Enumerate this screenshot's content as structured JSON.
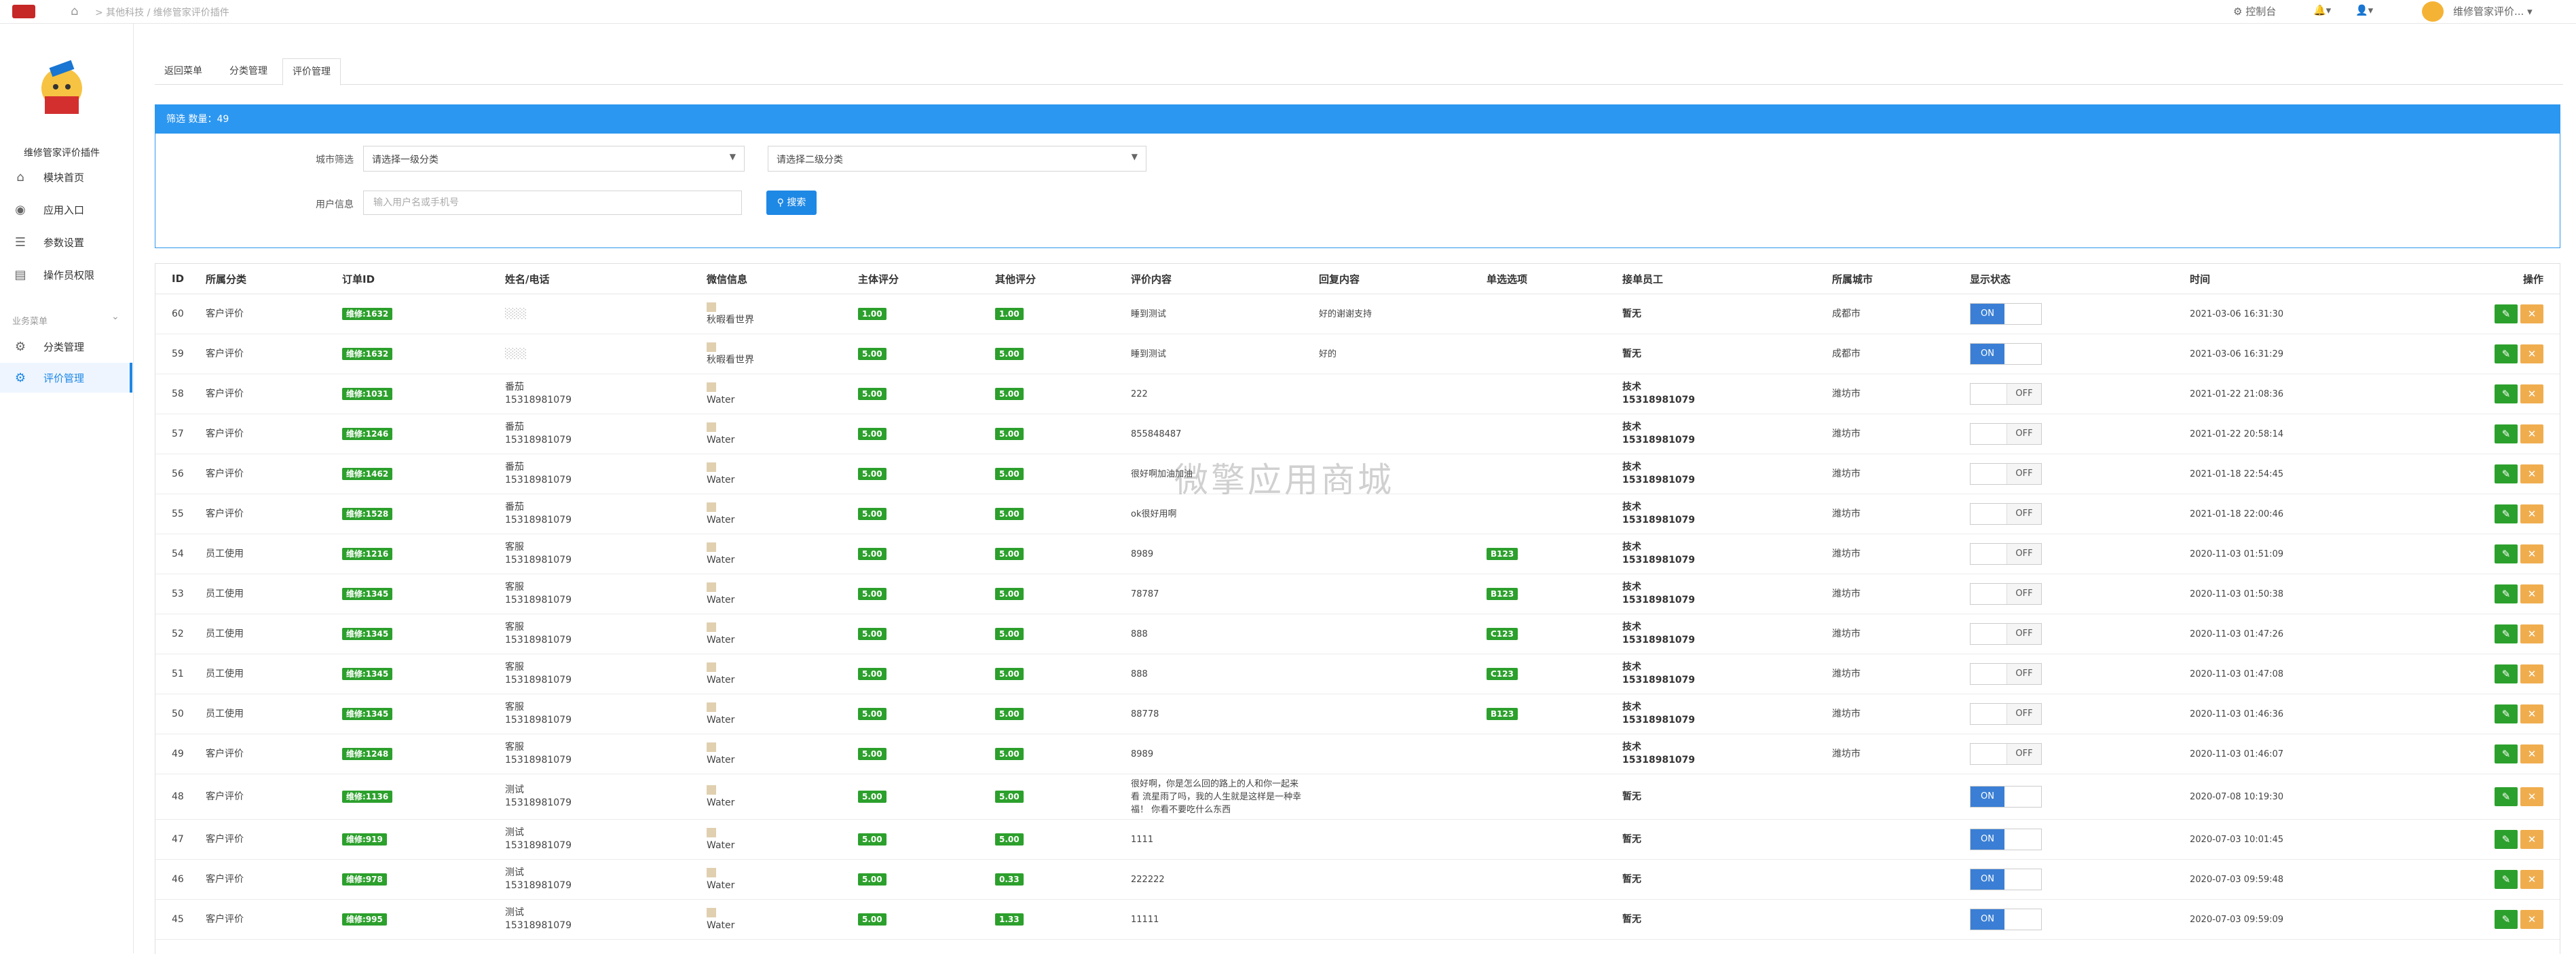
{
  "topbar": {
    "breadcrumb": "> 其他科技 / 维修管家评价插件",
    "console_label": "控制台",
    "user_name": "维修管家评价...",
    "console_icon": "gear-icon",
    "bell_icon": "bell-icon",
    "user_icon": "user-icon"
  },
  "sidebar": {
    "app_name": "维修管家评价插件",
    "items": [
      {
        "label": "模块首页",
        "icon": "home-icon"
      },
      {
        "label": "应用入口",
        "icon": "entry-icon"
      },
      {
        "label": "参数设置",
        "icon": "list-icon"
      },
      {
        "label": "操作员权限",
        "icon": "doc-icon"
      }
    ],
    "section_title": "业务菜单",
    "section_items": [
      {
        "label": "分类管理",
        "icon": "gear-icon"
      },
      {
        "label": "评价管理",
        "icon": "gear-icon"
      }
    ]
  },
  "tabs": [
    "返回菜单",
    "分类管理",
    "评价管理"
  ],
  "filter": {
    "header": "筛选 数量：49",
    "city_label": "城市筛选",
    "select1": "请选择一级分类",
    "select2": "请选择二级分类",
    "user_label": "用户信息",
    "user_placeholder": "输入用户名或手机号",
    "search_label": "搜索"
  },
  "table": {
    "headers": [
      "ID",
      "所属分类",
      "订单ID",
      "姓名/电话",
      "微信信息",
      "主体评分",
      "其他评分",
      "评价内容",
      "回复内容",
      "单选选项",
      "接单员工",
      "所属城市",
      "显示状态",
      "时间",
      "操作"
    ],
    "rows": [
      {
        "id": "60",
        "cat": "客户评价",
        "order": "维修:1632",
        "name": "",
        "phone": "",
        "wx": "秋暇看世界",
        "s1": "1.00",
        "s2": "1.00",
        "content": "睡到测试",
        "reply": "好的谢谢支持",
        "opt": "",
        "staff": "暂无",
        "staff_phone": "",
        "city": "成都市",
        "status": "ON",
        "time": "2021-03-06 16:31:30"
      },
      {
        "id": "59",
        "cat": "客户评价",
        "order": "维修:1632",
        "name": "",
        "phone": "",
        "wx": "秋暇看世界",
        "s1": "5.00",
        "s2": "5.00",
        "content": "睡到测试",
        "reply": "好的",
        "opt": "",
        "staff": "暂无",
        "staff_phone": "",
        "city": "成都市",
        "status": "ON",
        "time": "2021-03-06 16:31:29"
      },
      {
        "id": "58",
        "cat": "客户评价",
        "order": "维修:1031",
        "name": "番茄",
        "phone": "15318981079",
        "wx": "Water",
        "s1": "5.00",
        "s2": "5.00",
        "content": "222",
        "reply": "",
        "opt": "",
        "staff": "技术",
        "staff_phone": "15318981079",
        "city": "潍坊市",
        "status": "OFF",
        "time": "2021-01-22 21:08:36"
      },
      {
        "id": "57",
        "cat": "客户评价",
        "order": "维修:1246",
        "name": "番茄",
        "phone": "15318981079",
        "wx": "Water",
        "s1": "5.00",
        "s2": "5.00",
        "content": "855848487",
        "reply": "",
        "opt": "",
        "staff": "技术",
        "staff_phone": "15318981079",
        "city": "潍坊市",
        "status": "OFF",
        "time": "2021-01-22 20:58:14"
      },
      {
        "id": "56",
        "cat": "客户评价",
        "order": "维修:1462",
        "name": "番茄",
        "phone": "15318981079",
        "wx": "Water",
        "s1": "5.00",
        "s2": "5.00",
        "content": "很好啊加油加油",
        "reply": "",
        "opt": "",
        "staff": "技术",
        "staff_phone": "15318981079",
        "city": "潍坊市",
        "status": "OFF",
        "time": "2021-01-18 22:54:45"
      },
      {
        "id": "55",
        "cat": "客户评价",
        "order": "维修:1528",
        "name": "番茄",
        "phone": "15318981079",
        "wx": "Water",
        "s1": "5.00",
        "s2": "5.00",
        "content": "ok很好用啊",
        "reply": "",
        "opt": "",
        "staff": "技术",
        "staff_phone": "15318981079",
        "city": "潍坊市",
        "status": "OFF",
        "time": "2021-01-18 22:00:46"
      },
      {
        "id": "54",
        "cat": "员工使用",
        "order": "维修:1216",
        "name": "客服",
        "phone": "15318981079",
        "wx": "Water",
        "s1": "5.00",
        "s2": "5.00",
        "content": "8989",
        "reply": "",
        "opt": "B123",
        "staff": "技术",
        "staff_phone": "15318981079",
        "city": "潍坊市",
        "status": "OFF",
        "time": "2020-11-03 01:51:09"
      },
      {
        "id": "53",
        "cat": "员工使用",
        "order": "维修:1345",
        "name": "客服",
        "phone": "15318981079",
        "wx": "Water",
        "s1": "5.00",
        "s2": "5.00",
        "content": "78787",
        "reply": "",
        "opt": "B123",
        "staff": "技术",
        "staff_phone": "15318981079",
        "city": "潍坊市",
        "status": "OFF",
        "time": "2020-11-03 01:50:38"
      },
      {
        "id": "52",
        "cat": "员工使用",
        "order": "维修:1345",
        "name": "客服",
        "phone": "15318981079",
        "wx": "Water",
        "s1": "5.00",
        "s2": "5.00",
        "content": "888",
        "reply": "",
        "opt": "C123",
        "staff": "技术",
        "staff_phone": "15318981079",
        "city": "潍坊市",
        "status": "OFF",
        "time": "2020-11-03 01:47:26"
      },
      {
        "id": "51",
        "cat": "员工使用",
        "order": "维修:1345",
        "name": "客服",
        "phone": "15318981079",
        "wx": "Water",
        "s1": "5.00",
        "s2": "5.00",
        "content": "888",
        "reply": "",
        "opt": "C123",
        "staff": "技术",
        "staff_phone": "15318981079",
        "city": "潍坊市",
        "status": "OFF",
        "time": "2020-11-03 01:47:08"
      },
      {
        "id": "50",
        "cat": "员工使用",
        "order": "维修:1345",
        "name": "客服",
        "phone": "15318981079",
        "wx": "Water",
        "s1": "5.00",
        "s2": "5.00",
        "content": "88778",
        "reply": "",
        "opt": "B123",
        "staff": "技术",
        "staff_phone": "15318981079",
        "city": "潍坊市",
        "status": "OFF",
        "time": "2020-11-03 01:46:36"
      },
      {
        "id": "49",
        "cat": "客户评价",
        "order": "维修:1248",
        "name": "客服",
        "phone": "15318981079",
        "wx": "Water",
        "s1": "5.00",
        "s2": "5.00",
        "content": "8989",
        "reply": "",
        "opt": "",
        "staff": "技术",
        "staff_phone": "15318981079",
        "city": "潍坊市",
        "status": "OFF",
        "time": "2020-11-03 01:46:07"
      },
      {
        "id": "48",
        "cat": "客户评价",
        "order": "维修:1136",
        "name": "测试",
        "phone": "15318981079",
        "wx": "Water",
        "s1": "5.00",
        "s2": "5.00",
        "content": "很好啊，你是怎么回的路上的人和你一起来看 流星雨了吗，我的人生就是这样是一种幸福！ 你看不要吃什么东西",
        "reply": "",
        "opt": "",
        "staff": "暂无",
        "staff_phone": "",
        "city": "",
        "status": "ON",
        "time": "2020-07-08 10:19:30"
      },
      {
        "id": "47",
        "cat": "客户评价",
        "order": "维修:919",
        "name": "测试",
        "phone": "15318981079",
        "wx": "Water",
        "s1": "5.00",
        "s2": "5.00",
        "content": "1111",
        "reply": "",
        "opt": "",
        "staff": "暂无",
        "staff_phone": "",
        "city": "",
        "status": "ON",
        "time": "2020-07-03 10:01:45"
      },
      {
        "id": "46",
        "cat": "客户评价",
        "order": "维修:978",
        "name": "测试",
        "phone": "15318981079",
        "wx": "Water",
        "s1": "5.00",
        "s2": "0.33",
        "content": "222222",
        "reply": "",
        "opt": "",
        "staff": "暂无",
        "staff_phone": "",
        "city": "",
        "status": "ON",
        "time": "2020-07-03 09:59:48"
      },
      {
        "id": "45",
        "cat": "客户评价",
        "order": "维修:995",
        "name": "测试",
        "phone": "15318981079",
        "wx": "Water",
        "s1": "5.00",
        "s2": "1.33",
        "content": "11111",
        "reply": "",
        "opt": "",
        "staff": "暂无",
        "staff_phone": "",
        "city": "",
        "status": "ON",
        "time": "2020-07-03 09:59:09"
      }
    ]
  },
  "watermark": "微擎应用商城",
  "colors": {
    "primary": "#2c97f0",
    "success": "#2ca02c",
    "warning": "#f0ad4e",
    "toggle_on": "#3a7fd5"
  }
}
